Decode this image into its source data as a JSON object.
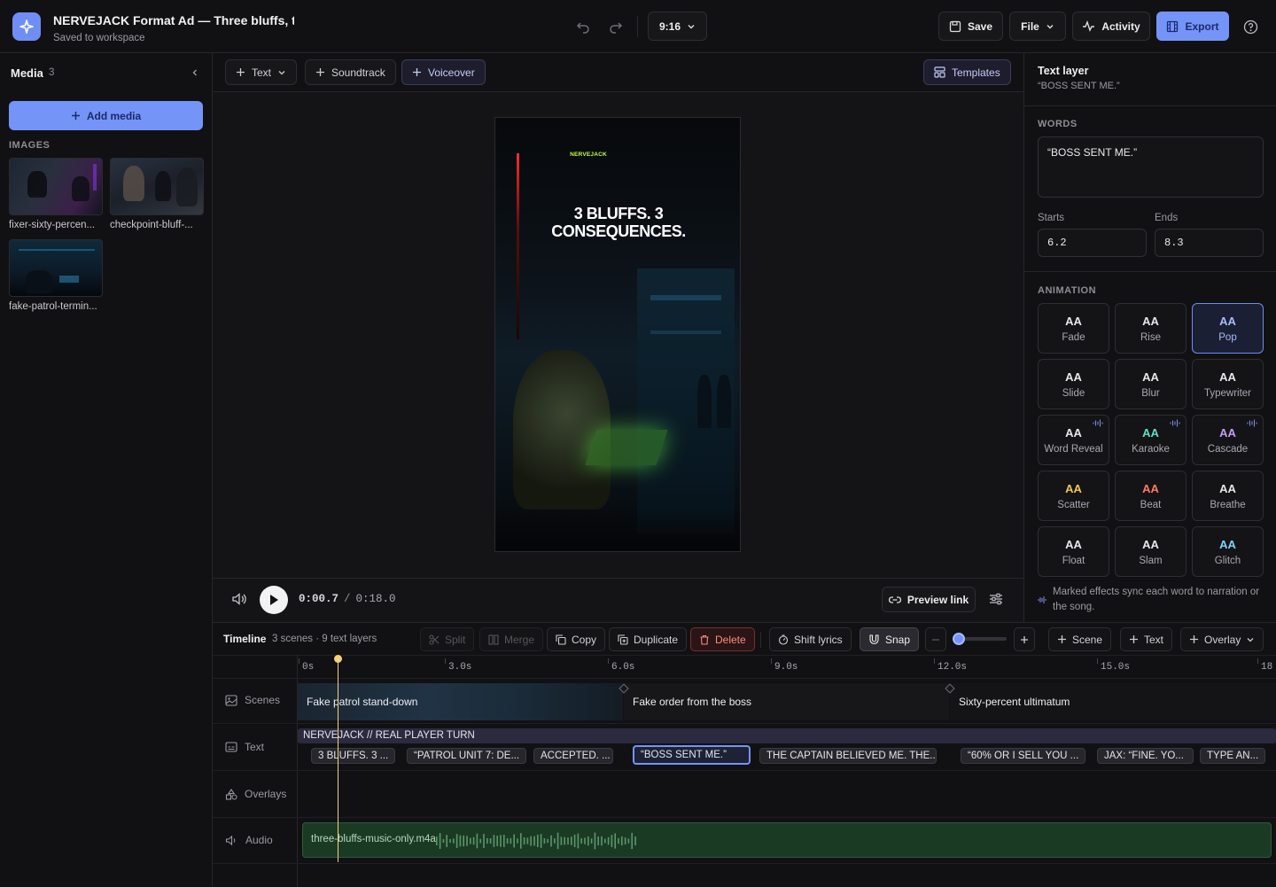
{
  "header": {
    "title": "NERVEJACK Format Ad — Three bluffs, three consequences",
    "subtitle": "Saved to workspace",
    "aspect": "9:16",
    "save": "Save",
    "file": "File",
    "activity": "Activity",
    "export": "Export"
  },
  "media": {
    "title": "Media",
    "count": "3",
    "add": "Add media",
    "section": "IMAGES",
    "items": [
      "fixer-sixty-percen...",
      "checkpoint-bluff-...",
      "fake-patrol-termin..."
    ]
  },
  "toolbar": {
    "text": "Text",
    "soundtrack": "Soundtrack",
    "voiceover": "Voiceover",
    "templates": "Templates"
  },
  "preview": {
    "brand": "NERVEJACK",
    "headline": "3 BLUFFS. 3 CONSEQUENCES.",
    "time_current": "0:00.7",
    "time_sep": "/",
    "time_total": "0:18.0",
    "preview_link": "Preview link"
  },
  "inspector": {
    "title": "Text layer",
    "subtitle": "“BOSS SENT ME.”",
    "words_label": "WORDS",
    "words_value": "“BOSS SENT ME.”",
    "starts_label": "Starts",
    "starts_value": "6.2",
    "ends_label": "Ends",
    "ends_value": "8.3",
    "animation_label": "ANIMATION",
    "animations": [
      {
        "name": "Fade",
        "color": "#e8e8ec",
        "sync": false
      },
      {
        "name": "Rise",
        "color": "#e8e8ec",
        "sync": false
      },
      {
        "name": "Pop",
        "color": "#a9bcff",
        "sync": false,
        "selected": true
      },
      {
        "name": "Slide",
        "color": "#e8e8ec",
        "sync": false
      },
      {
        "name": "Blur",
        "color": "#e8e8ec",
        "sync": false
      },
      {
        "name": "Typewriter",
        "color": "#e8e8ec",
        "sync": false
      },
      {
        "name": "Word Reveal",
        "color": "#e8e8ec",
        "sync": true
      },
      {
        "name": "Karaoke",
        "color": "#5fe0c4",
        "sync": true
      },
      {
        "name": "Cascade",
        "color": "#c79bff",
        "sync": true
      },
      {
        "name": "Scatter",
        "color": "#f2c84b",
        "sync": false
      },
      {
        "name": "Beat",
        "color": "#ff7a6b",
        "sync": false
      },
      {
        "name": "Breathe",
        "color": "#e8e8ec",
        "sync": false
      },
      {
        "name": "Float",
        "color": "#e8e8ec",
        "sync": false
      },
      {
        "name": "Slam",
        "color": "#e8e8ec",
        "sync": false
      },
      {
        "name": "Glitch",
        "color": "#7fd4ff",
        "sync": false
      }
    ],
    "note": "Marked effects sync each word to narration or the song."
  },
  "timeline": {
    "title": "Timeline",
    "summary": "3 scenes · 9 text layers",
    "split": "Split",
    "merge": "Merge",
    "copy": "Copy",
    "duplicate": "Duplicate",
    "delete": "Delete",
    "shift_lyrics": "Shift lyrics",
    "snap": "Snap",
    "scene": "Scene",
    "text": "Text",
    "overlay": "Overlay",
    "ruler": [
      "0s",
      "3.0s",
      "6.0s",
      "9.0s",
      "12.0s",
      "15.0s",
      "18"
    ],
    "tracks": {
      "scenes": "Scenes",
      "text": "Text",
      "overlays": "Overlays",
      "audio": "Audio"
    },
    "scenes": [
      "Fake patrol stand-down",
      "Fake order from the boss",
      "Sixty-percent ultimatum"
    ],
    "banner": "NERVEJACK // REAL PLAYER TURN",
    "text_clips": [
      "3 BLUFFS. 3 ...",
      "“PATROL UNIT 7: DE...",
      "ACCEPTED. ...",
      "“BOSS SENT ME.”",
      "THE CAPTAIN BELIEVED ME. THE...",
      "“60% OR I SELL YOU ...",
      "JAX: “FINE. YO...",
      "TYPE AN..."
    ],
    "audio_clip": "three-bluffs-music-only.m4a"
  },
  "colors": {
    "accent": "#7594f7",
    "delete": "#ff6b6b",
    "brand_green": "#c8ff3c",
    "playhead": "#f4d27a"
  }
}
